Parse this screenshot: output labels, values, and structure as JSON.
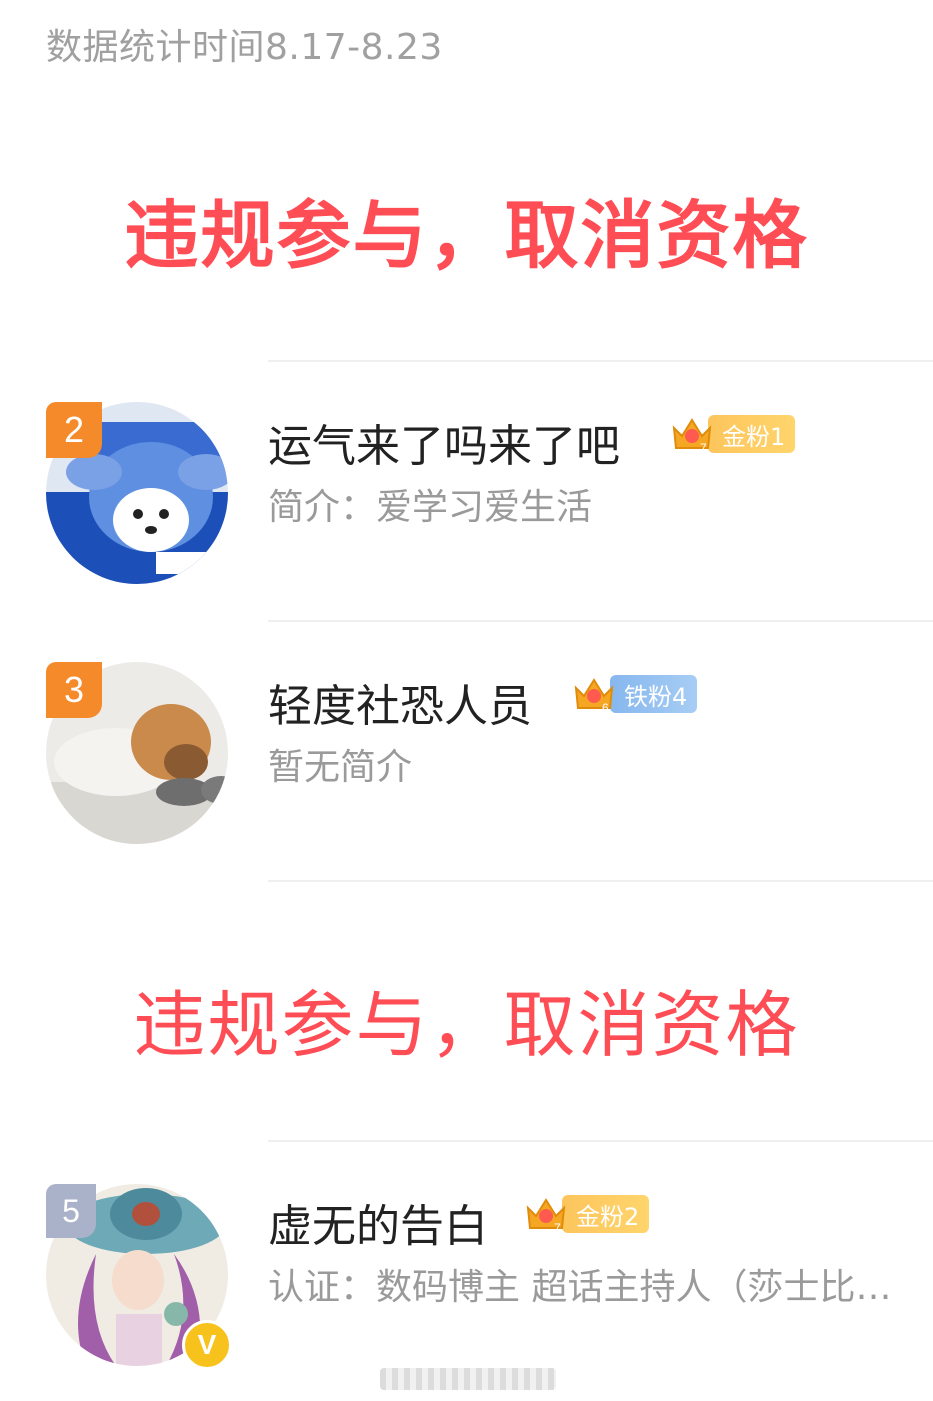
{
  "header": {
    "date_range": "数据统计时间8.17-8.23"
  },
  "banners": {
    "first": "违规参与，取消资格",
    "second": "违规参与，取消资格"
  },
  "users": [
    {
      "rank": "2",
      "name": "运气来了吗来了吧",
      "badge_label": "金粉1",
      "badge_level": "7",
      "badge_type": "gold",
      "intro": "简介：爱学习爱生活"
    },
    {
      "rank": "3",
      "name": "轻度社恐人员",
      "badge_label": "铁粉4",
      "badge_level": "6",
      "badge_type": "iron",
      "intro": "暂无简介"
    },
    {
      "rank": "5",
      "name": "虚无的告白",
      "badge_label": "金粉2",
      "badge_level": "7",
      "badge_type": "gold",
      "intro": "认证：数码博主 超话主持人（莎士比…",
      "verified": "V"
    }
  ],
  "colors": {
    "banner": "#ff4d55",
    "rank_orange": "#f58a2b",
    "rank_gray": "#a9b2c8",
    "gold_badge": "#fcc55c",
    "iron_badge": "#86b7ee"
  }
}
